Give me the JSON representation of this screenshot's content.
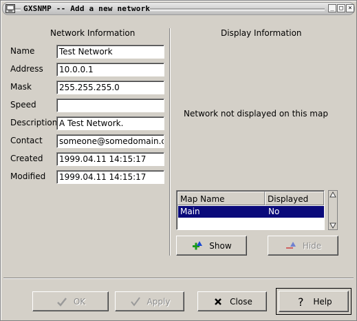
{
  "window": {
    "title": "GXSNMP -- Add a new network"
  },
  "network_info": {
    "heading": "Network Information",
    "fields": [
      {
        "label": "Name",
        "value": "Test Network"
      },
      {
        "label": "Address",
        "value": "10.0.0.1"
      },
      {
        "label": "Mask",
        "value": "255.255.255.0"
      },
      {
        "label": "Speed",
        "value": ""
      },
      {
        "label": "Description",
        "value": "A Test Network."
      },
      {
        "label": "Contact",
        "value": "someone@somedomain.com"
      },
      {
        "label": "Created",
        "value": "1999.04.11 14:15:17"
      },
      {
        "label": "Modified",
        "value": "1999.04.11 14:15:17"
      }
    ]
  },
  "display_info": {
    "heading": "Display Information",
    "status": "Network not displayed on this map",
    "table": {
      "columns": [
        "Map Name",
        "Displayed"
      ],
      "rows": [
        {
          "map_name": "Main",
          "displayed": "No"
        }
      ]
    },
    "show_label": "Show",
    "hide_label": "Hide"
  },
  "buttons": {
    "ok": "OK",
    "apply": "Apply",
    "close": "Close",
    "help": "Help"
  },
  "icons": [
    "minimize-icon",
    "maximize-icon",
    "close-window-icon",
    "add-icon",
    "remove-icon",
    "check-icon",
    "x-icon",
    "question-icon"
  ]
}
